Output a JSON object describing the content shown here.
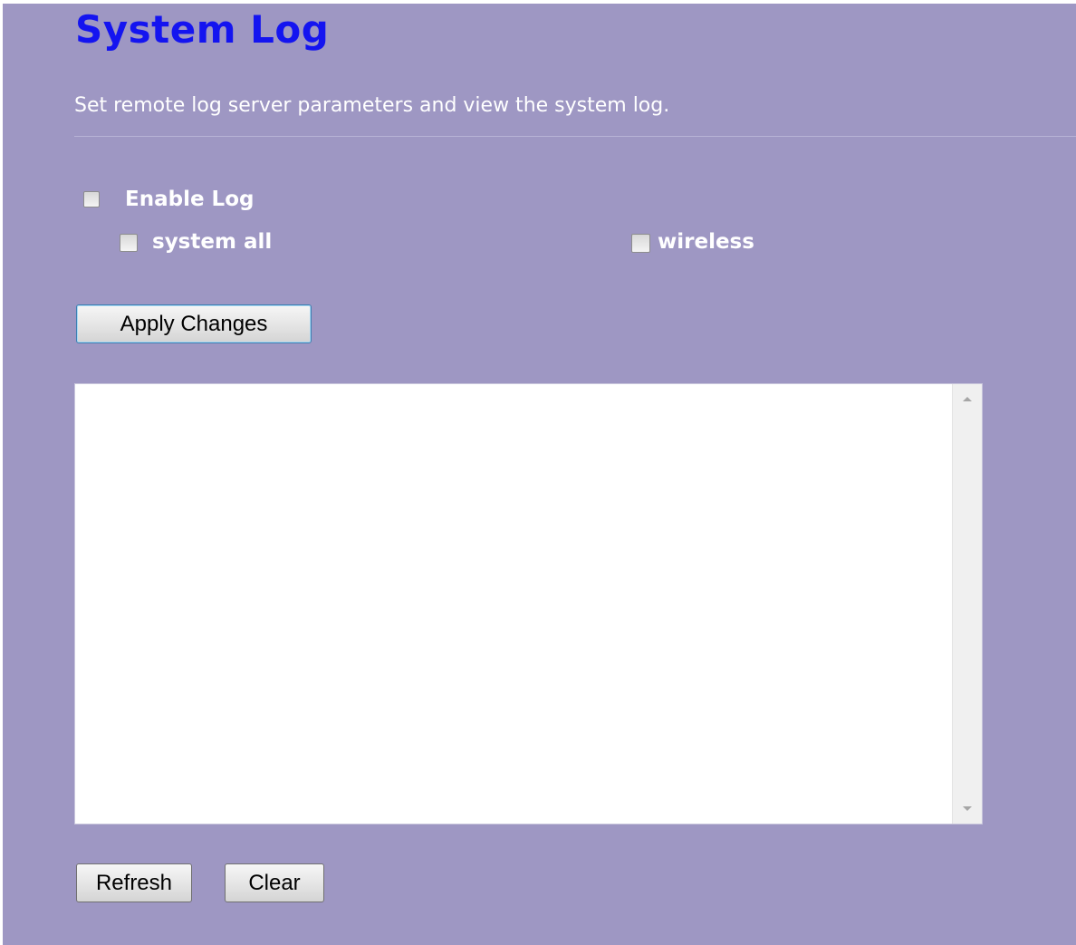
{
  "page": {
    "title": "System Log",
    "description": "Set remote log server parameters and view the system log."
  },
  "options": {
    "enable_log": {
      "label": "Enable Log",
      "checked": false
    },
    "system_all": {
      "label": "system all",
      "checked": false
    },
    "wireless": {
      "label": "wireless",
      "checked": false
    }
  },
  "buttons": {
    "apply": "Apply Changes",
    "refresh": "Refresh",
    "clear": "Clear"
  },
  "log": {
    "content": ""
  },
  "colors": {
    "background": "#9e97c3",
    "title": "#1414f0",
    "text": "#ffffff"
  },
  "icons": {
    "scroll_up": "scroll-up-arrow-icon",
    "scroll_down": "scroll-down-arrow-icon"
  }
}
